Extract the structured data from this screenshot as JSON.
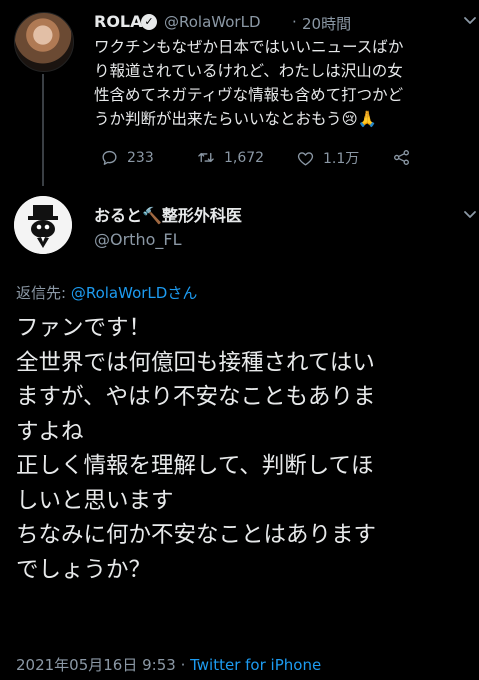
{
  "tweet1": {
    "name": "ROLA",
    "handle": "@RolaWorLD",
    "separator": "·",
    "time": "20時間",
    "text": "ワクチンもなぜか日本ではいいニュースばか\nり報道されているけれど、わたしは沢山の女\n性含めてネガティヴな情報も含めて打つかど\nうか判断が出来たらいいなとおもう😢🙏",
    "actions": {
      "replies": "233",
      "retweets": "1,672",
      "likes": "1.1万"
    }
  },
  "tweet2": {
    "name": "おると🔨整形外科医",
    "handle": "@Ortho_FL",
    "replying_prefix": "返信先: ",
    "replying_handle": "@RolaWorLDさん",
    "text": "ファンです！\n全世界では何億回も接種されてはい\nますが、やはり不安なこともありま\nすよね\n正しく情報を理解して、判断してほ\nしいと思います\nちなみに何か不安なことはあります\nでしょうか？",
    "timestamp": "2021年05月16日 9:53 · ",
    "source": "Twitter for iPhone"
  },
  "colors": {
    "background": "#000000",
    "text": "#e7e9ea",
    "muted": "#8b98a5",
    "link": "#1d9bf0"
  },
  "icons": [
    "verified-badge-icon",
    "chevron-down-icon",
    "reply-icon",
    "retweet-icon",
    "like-icon",
    "share-icon"
  ]
}
